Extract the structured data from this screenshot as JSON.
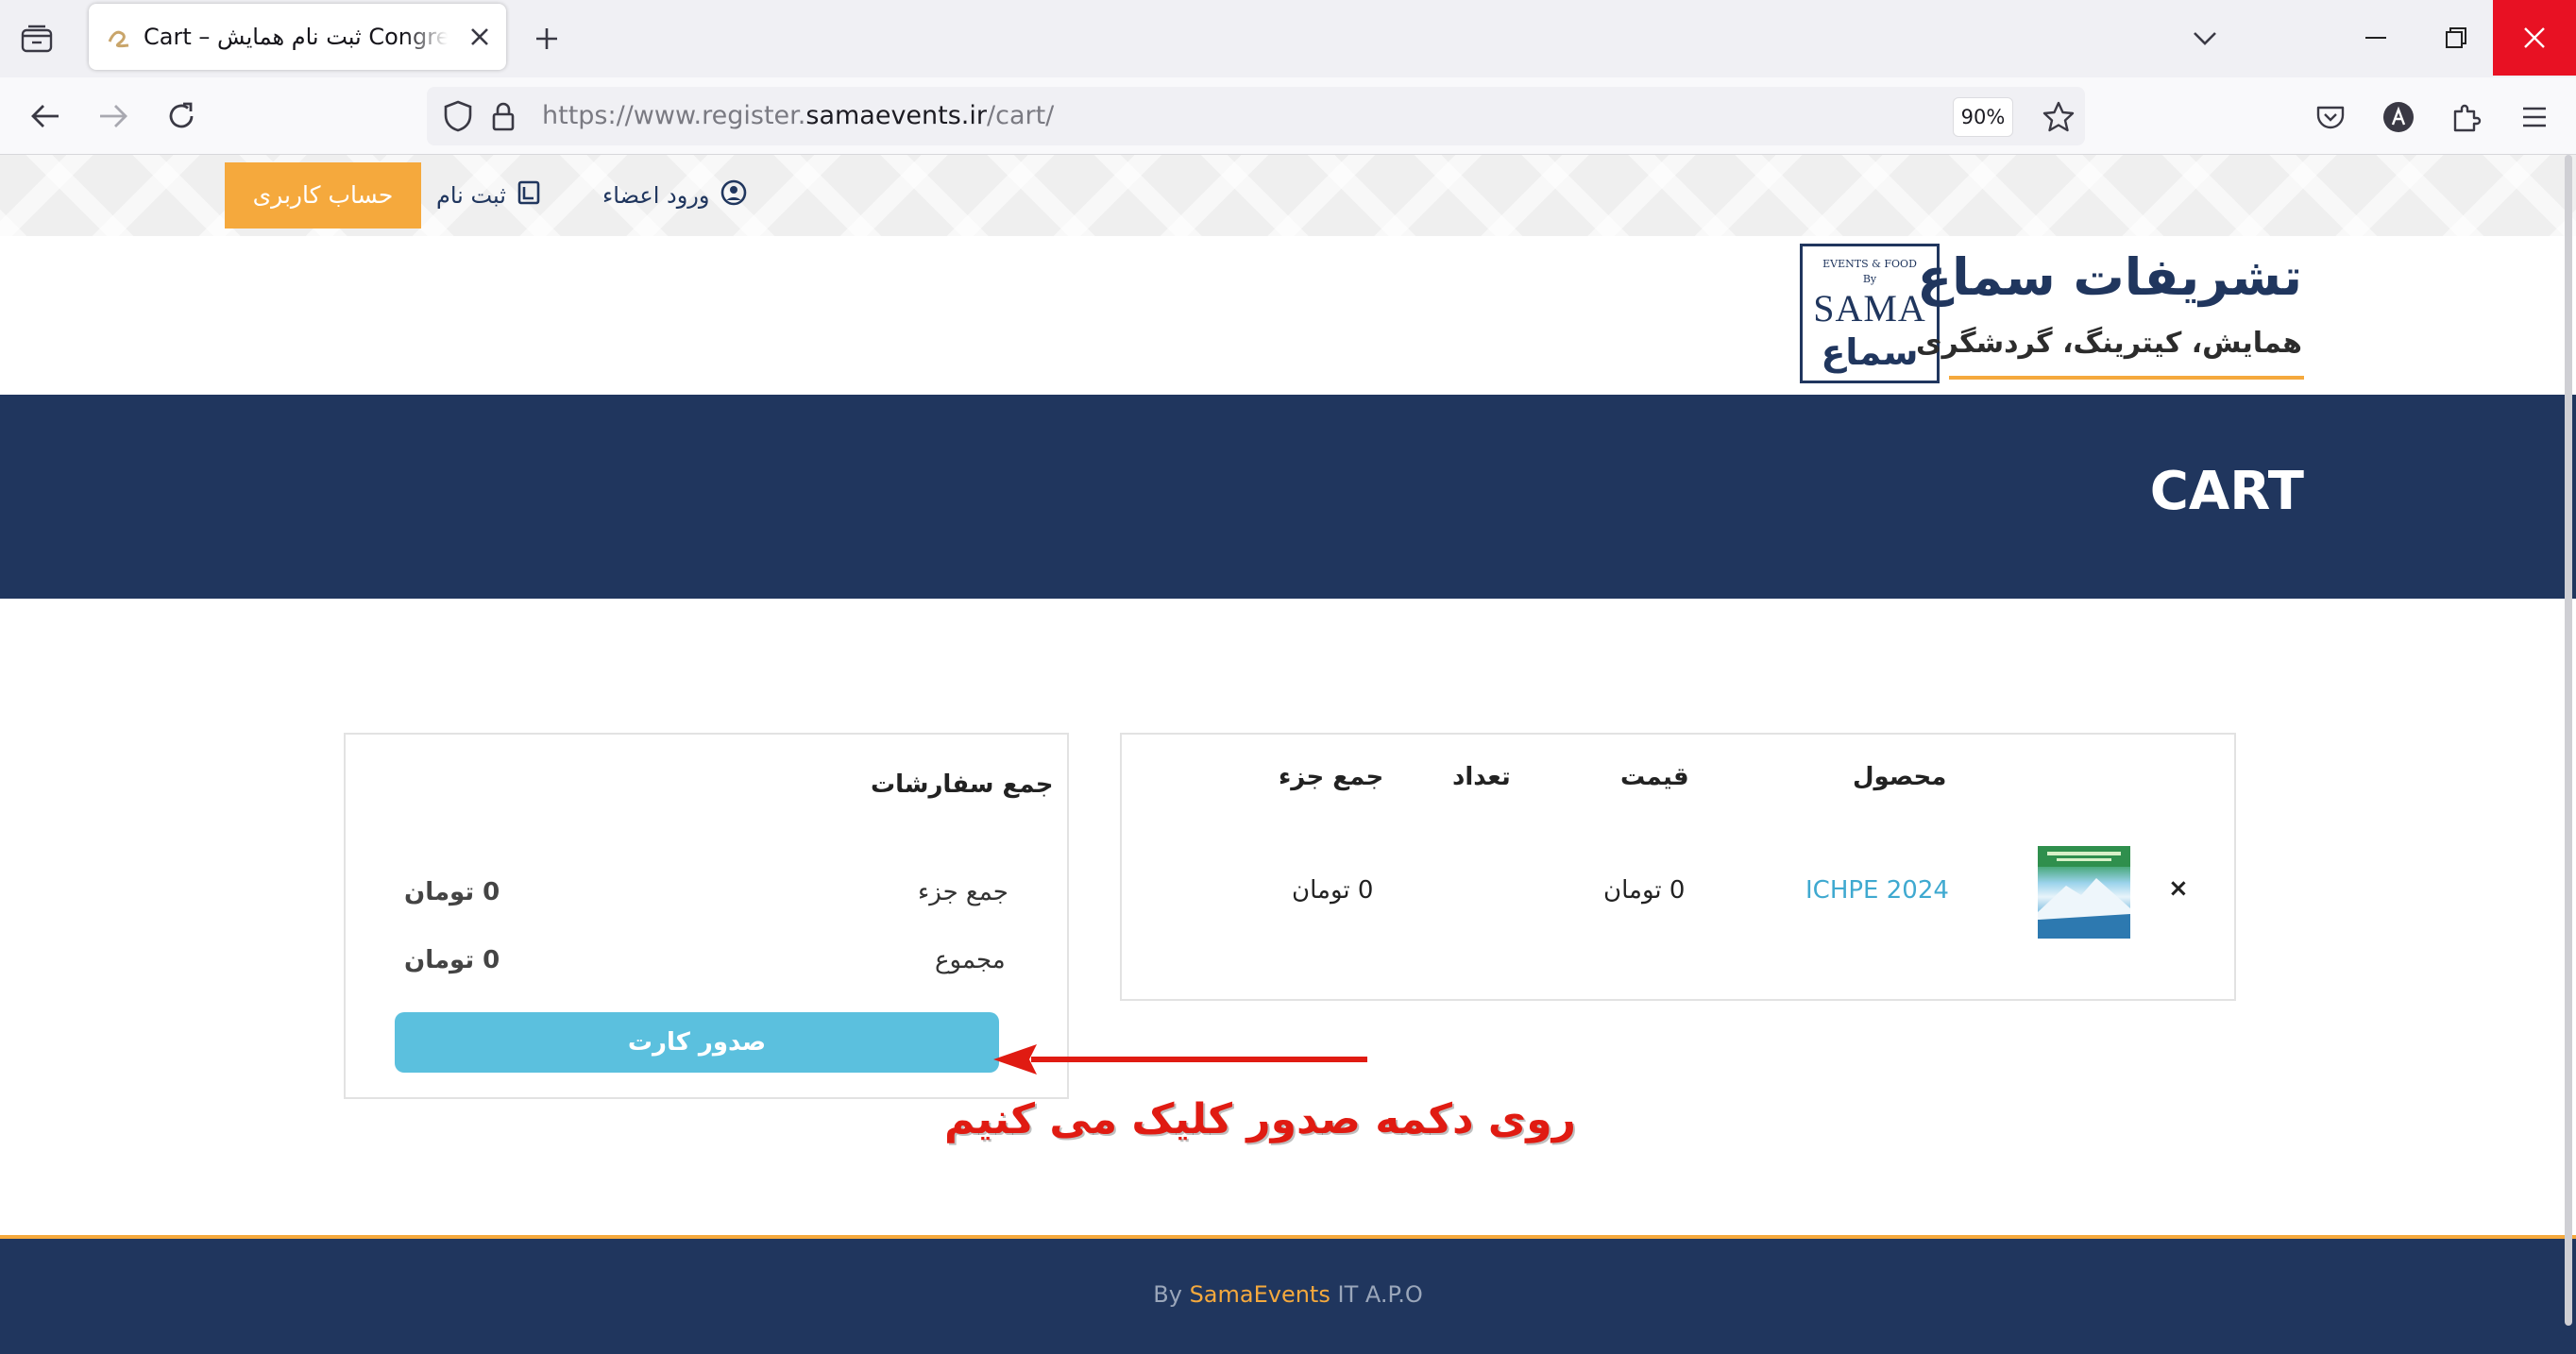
{
  "browser": {
    "tab_title": "Cart – ثبت نام همایش Congress",
    "url_scheme": "https://www.register.",
    "url_host": "samaevents.ir",
    "url_path": "/cart/",
    "zoom": "90%"
  },
  "site": {
    "topbar": {
      "account_button": "حساب کاربری",
      "register_link": "ثبت نام",
      "login_link": "ورود اعضاء"
    },
    "logo": {
      "title": "تشریفات سماع",
      "subtitle": "همایش، کیترینگ، گردشگری",
      "badge_top": "EVENTS & FOOD",
      "badge_by": "By",
      "badge_main": "SAMA",
      "badge_bottom": "سماع"
    },
    "hero_title": "CART"
  },
  "cart": {
    "headers": {
      "product": "محصول",
      "price": "قیمت",
      "quantity": "تعداد",
      "subtotal": "جمع جزء"
    },
    "items": [
      {
        "remove": "×",
        "product": "ICHPE 2024",
        "price": "0 تومان",
        "subtotal": "0 تومان"
      }
    ]
  },
  "totals": {
    "title": "جمع سفارشات",
    "subtotal_label": "جمع جزء",
    "subtotal_value": "0 تومان",
    "total_label": "مجموع",
    "total_value": "0 تومان",
    "checkout_button": "صدور کارت"
  },
  "annotation": "روی دکمه صدور کلیک می کنیم",
  "footer": {
    "prefix": "By",
    "brand": "SamaEvents",
    "suffix": "IT A.P.O"
  },
  "colors": {
    "navy": "#20365e",
    "accent_orange": "#f5a93d",
    "button_blue": "#5bc0de",
    "link_blue": "#3fa9d0",
    "annotation_red": "#e01b12"
  }
}
